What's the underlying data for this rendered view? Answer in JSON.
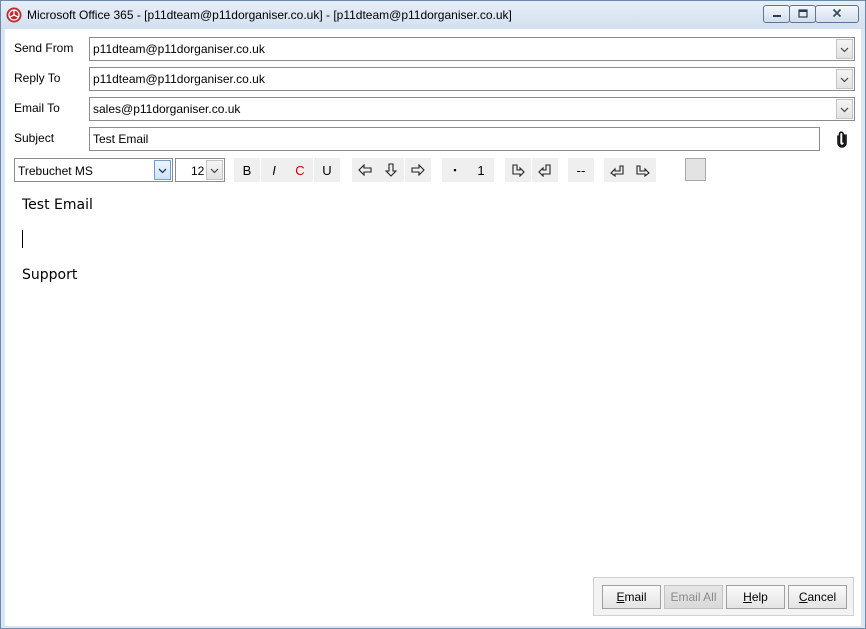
{
  "window": {
    "title": "Microsoft Office 365 - [p11dteam@p11dorganiser.co.uk] - [p11dteam@p11dorganiser.co.uk]",
    "icon": "app-logo-icon",
    "controls": [
      "minimize-icon",
      "maximize-icon",
      "close-icon"
    ]
  },
  "form": {
    "send_from": {
      "label": "Send From",
      "value": "p11dteam@p11dorganiser.co.uk"
    },
    "reply_to": {
      "label": "Reply To",
      "value": "p11dteam@p11dorganiser.co.uk"
    },
    "email_to": {
      "label": "Email To",
      "value": "sales@p11dorganiser.co.uk"
    },
    "subject": {
      "label": "Subject",
      "value": "Test Email"
    },
    "attach_icon": "paperclip-icon"
  },
  "toolbar": {
    "font": "Trebuchet MS",
    "size": "12",
    "bold": "B",
    "italic": "I",
    "color": "C",
    "underline": "U",
    "bullet": "▪",
    "number": "1",
    "rule": "--",
    "color_accent": "#d40000"
  },
  "body": {
    "line1": "Test Email",
    "line3": "Support"
  },
  "buttons": {
    "email": {
      "pre": "",
      "u": "E",
      "post": "mail"
    },
    "email_all": "Email All",
    "help": {
      "pre": "",
      "u": "H",
      "post": "elp"
    },
    "cancel": {
      "pre": "",
      "u": "C",
      "post": "ancel"
    }
  }
}
